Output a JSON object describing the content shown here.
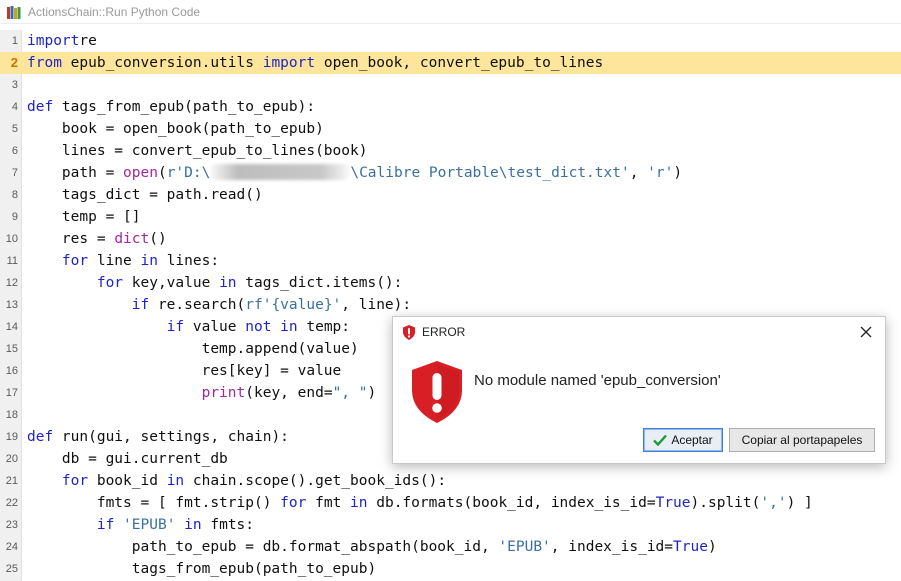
{
  "window": {
    "title": "ActionsChain::Run Python Code",
    "app_icon": "books-icon"
  },
  "editor": {
    "current_line": 2,
    "lines": [
      {
        "n": "1",
        "tokens": [
          [
            "kw",
            "import"
          ],
          [
            "",
            "re"
          ]
        ]
      },
      {
        "n": "2",
        "tokens": [
          [
            "kw",
            "from"
          ],
          [
            "",
            " epub_conversion.utils "
          ],
          [
            "kw",
            "import"
          ],
          [
            "",
            " open_book, convert_epub_to_lines"
          ]
        ]
      },
      {
        "n": "3",
        "tokens": []
      },
      {
        "n": "4",
        "tokens": [
          [
            "kw",
            "def"
          ],
          [
            "",
            " tags_from_epub(path_to_epub):"
          ]
        ]
      },
      {
        "n": "5",
        "tokens": [
          [
            "",
            "    book = open_book(path_to_epub)"
          ]
        ]
      },
      {
        "n": "6",
        "tokens": [
          [
            "",
            "    lines = convert_epub_to_lines(book)"
          ]
        ]
      },
      {
        "n": "7",
        "tokens": [
          [
            "",
            "    path = "
          ],
          [
            "bi",
            "open"
          ],
          [
            "",
            "("
          ],
          [
            "st",
            "r'D:\\"
          ],
          [
            "blur",
            ""
          ],
          [
            "st",
            "\\Calibre Portable\\test_dict.txt'"
          ],
          [
            "",
            ", "
          ],
          [
            "st",
            "'r'"
          ],
          [
            "",
            ")"
          ]
        ]
      },
      {
        "n": "8",
        "tokens": [
          [
            "",
            "    tags_dict = path.read()"
          ]
        ]
      },
      {
        "n": "9",
        "tokens": [
          [
            "",
            "    temp = []"
          ]
        ]
      },
      {
        "n": "10",
        "tokens": [
          [
            "",
            "    res = "
          ],
          [
            "bi",
            "dict"
          ],
          [
            "",
            "()"
          ]
        ]
      },
      {
        "n": "11",
        "tokens": [
          [
            "kw",
            "    for"
          ],
          [
            "",
            " line "
          ],
          [
            "kw",
            "in"
          ],
          [
            "",
            " lines:"
          ]
        ]
      },
      {
        "n": "12",
        "tokens": [
          [
            "kw",
            "        for"
          ],
          [
            "",
            " key,value "
          ],
          [
            "kw",
            "in"
          ],
          [
            "",
            " tags_dict.items():"
          ]
        ]
      },
      {
        "n": "13",
        "tokens": [
          [
            "kw",
            "            if"
          ],
          [
            "",
            " re.search("
          ],
          [
            "st",
            "rf'{value}'"
          ],
          [
            "",
            ", line):"
          ]
        ]
      },
      {
        "n": "14",
        "tokens": [
          [
            "kw",
            "                if"
          ],
          [
            "",
            " value "
          ],
          [
            "kw",
            "not in"
          ],
          [
            "",
            " temp:"
          ]
        ]
      },
      {
        "n": "15",
        "tokens": [
          [
            "",
            "                    temp.append(value)"
          ]
        ]
      },
      {
        "n": "16",
        "tokens": [
          [
            "",
            "                    res[key] = value"
          ]
        ]
      },
      {
        "n": "17",
        "tokens": [
          [
            "bi",
            "                    print"
          ],
          [
            "",
            "(key, end="
          ],
          [
            "st",
            "\", \""
          ],
          [
            "",
            ")"
          ]
        ]
      },
      {
        "n": "18",
        "tokens": []
      },
      {
        "n": "19",
        "tokens": [
          [
            "kw",
            "def"
          ],
          [
            "",
            " run(gui, settings, chain):"
          ]
        ]
      },
      {
        "n": "20",
        "tokens": [
          [
            "",
            "    db = gui.current_db"
          ]
        ]
      },
      {
        "n": "21",
        "tokens": [
          [
            "kw",
            "    for"
          ],
          [
            "",
            " book_id "
          ],
          [
            "kw",
            "in"
          ],
          [
            "",
            " chain.scope().get_book_ids():"
          ]
        ]
      },
      {
        "n": "22",
        "tokens": [
          [
            "",
            "        fmts = [ fmt.strip() "
          ],
          [
            "kw",
            "for"
          ],
          [
            "",
            " fmt "
          ],
          [
            "kw",
            "in"
          ],
          [
            "",
            " db.formats(book_id, index_is_id="
          ],
          [
            "kw",
            "True"
          ],
          [
            "",
            ").split("
          ],
          [
            "st",
            "','"
          ],
          [
            "",
            ") ]"
          ]
        ]
      },
      {
        "n": "23",
        "tokens": [
          [
            "kw",
            "        if"
          ],
          [
            "",
            " "
          ],
          [
            "st",
            "'EPUB'"
          ],
          [
            "",
            " "
          ],
          [
            "kw",
            "in"
          ],
          [
            "",
            " fmts:"
          ]
        ]
      },
      {
        "n": "24",
        "tokens": [
          [
            "",
            "            path_to_epub = db.format_abspath(book_id, "
          ],
          [
            "st",
            "'EPUB'"
          ],
          [
            "",
            ", index_is_id="
          ],
          [
            "kw",
            "True"
          ],
          [
            "",
            ")"
          ]
        ]
      },
      {
        "n": "25",
        "tokens": [
          [
            "",
            "            tags_from_epub(path_to_epub)"
          ]
        ]
      }
    ]
  },
  "dialog": {
    "title": "ERROR",
    "message": "No module named 'epub_conversion'",
    "accept_label": "Aceptar",
    "copy_label": "Copiar al portapapeles",
    "icon": "error-shield-icon",
    "close_icon": "close-icon",
    "accept_icon": "check-icon"
  },
  "colors": {
    "keyword": "#1f24c8",
    "builtin": "#a526a5",
    "string": "#3a6fa0",
    "current_line": "#fde59b",
    "error_red": "#d81f26"
  }
}
